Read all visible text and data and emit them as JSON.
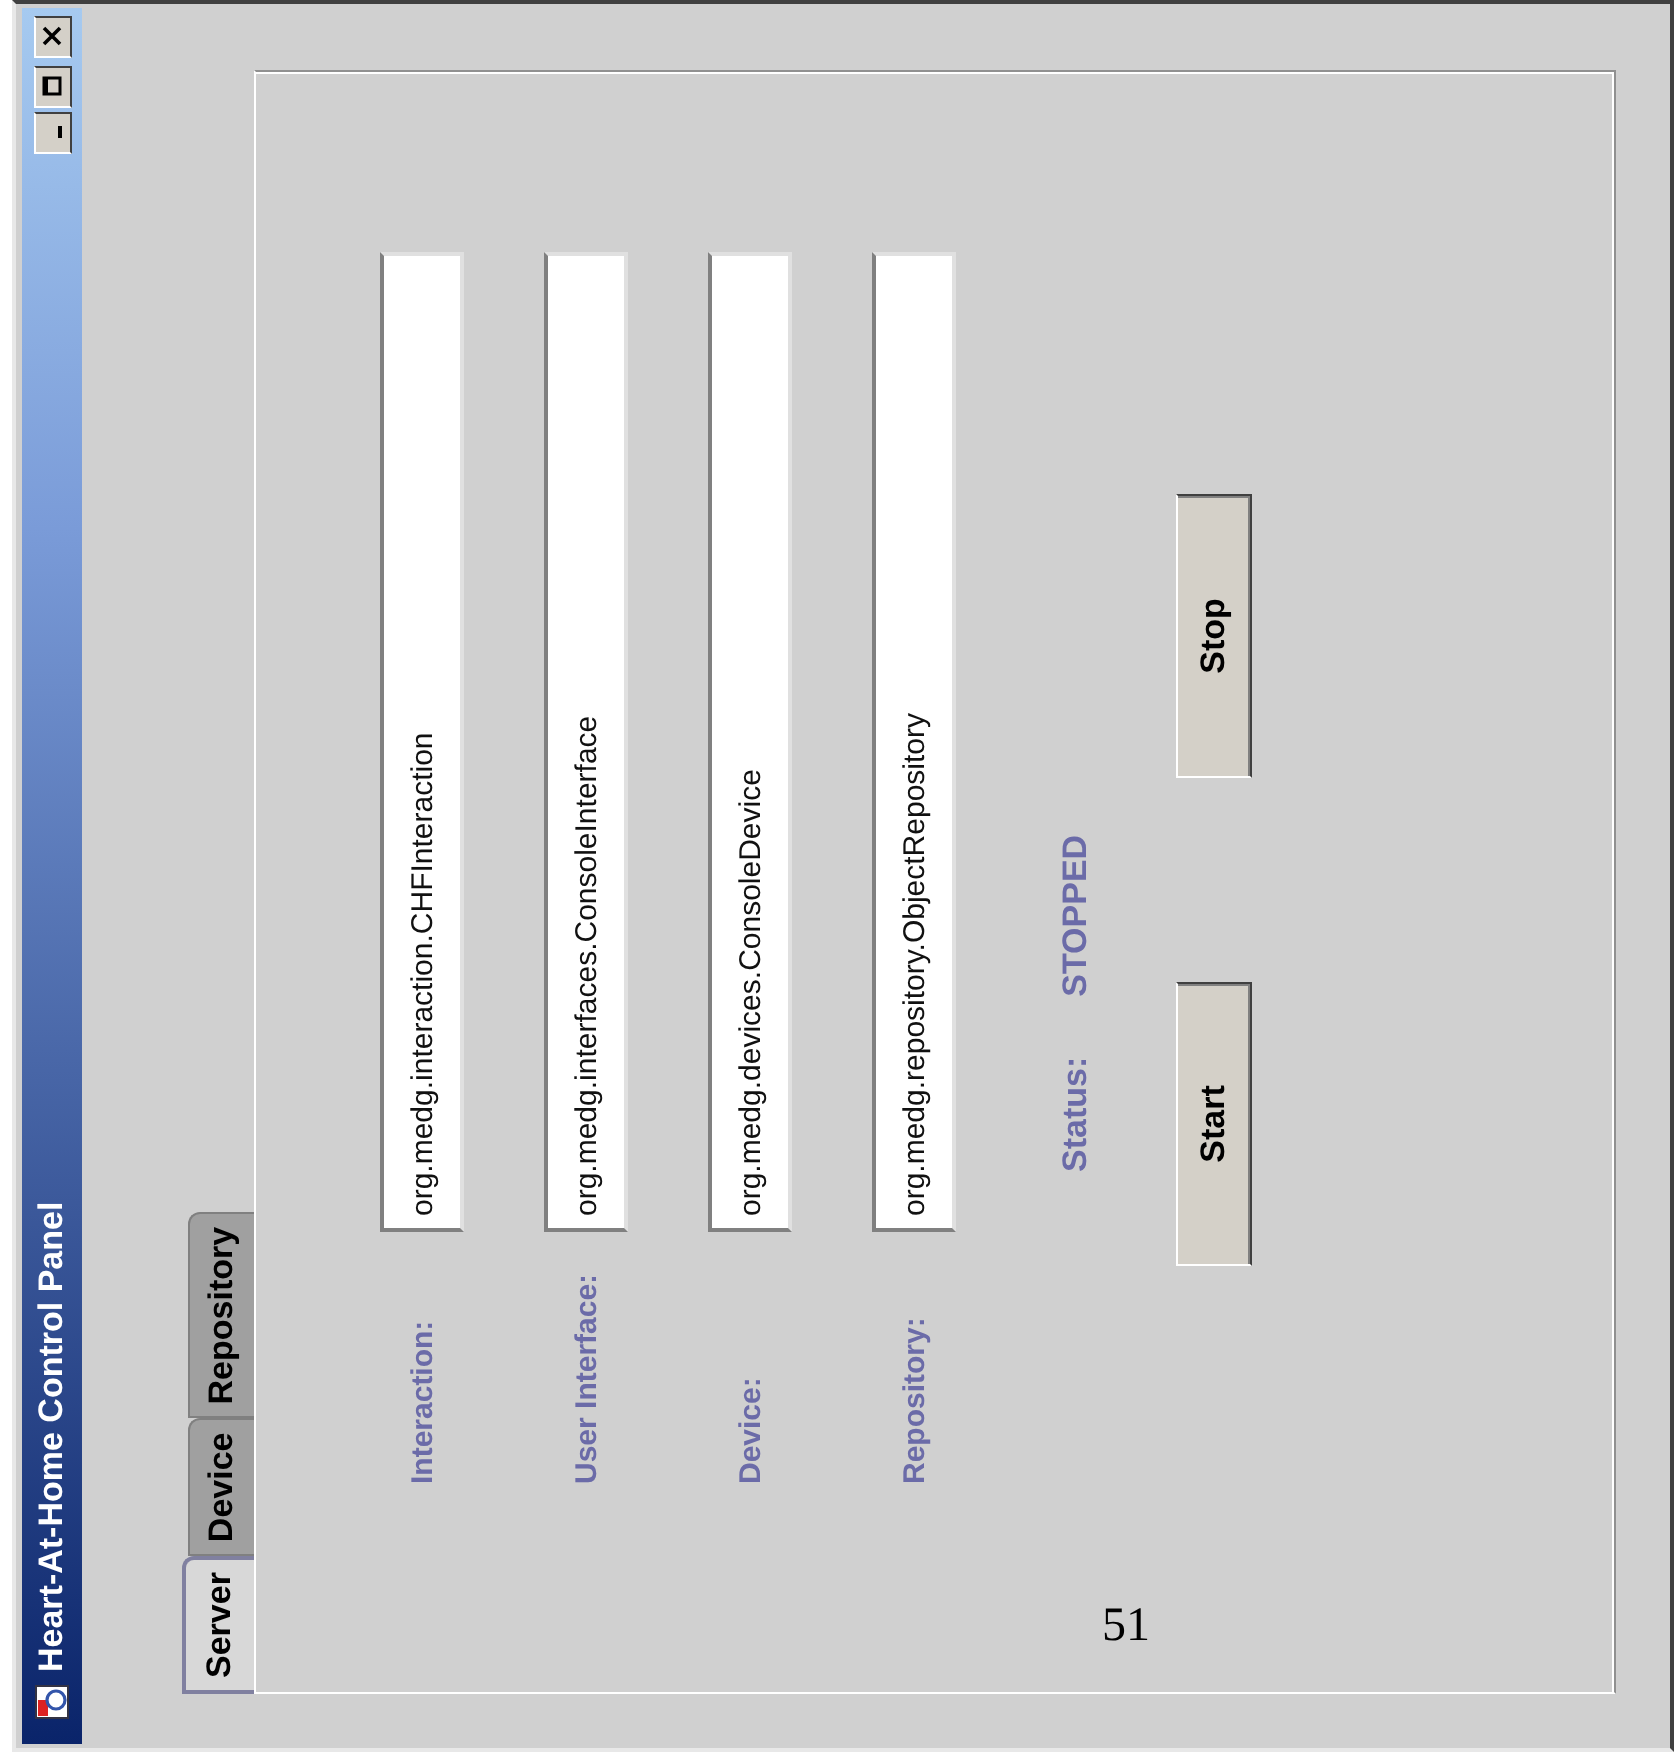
{
  "window": {
    "title": "Heart-At-Home Control Panel"
  },
  "tabs": [
    {
      "label": "Server",
      "selected": true
    },
    {
      "label": "Device",
      "selected": false
    },
    {
      "label": "Repository",
      "selected": false
    }
  ],
  "fields": [
    {
      "label": "Interaction:",
      "value": "org.medg.interaction.CHFInteraction"
    },
    {
      "label": "User Interface:",
      "value": "org.medg.interfaces.ConsoleInterface"
    },
    {
      "label": "Device:",
      "value": "org.medg.devices.ConsoleDevice"
    },
    {
      "label": "Repository:",
      "value": "org.medg.repository.ObjectRepository"
    }
  ],
  "status": {
    "label": "Status:",
    "value": "STOPPED"
  },
  "buttons": [
    "Start",
    "Stop"
  ],
  "page_number": "51"
}
